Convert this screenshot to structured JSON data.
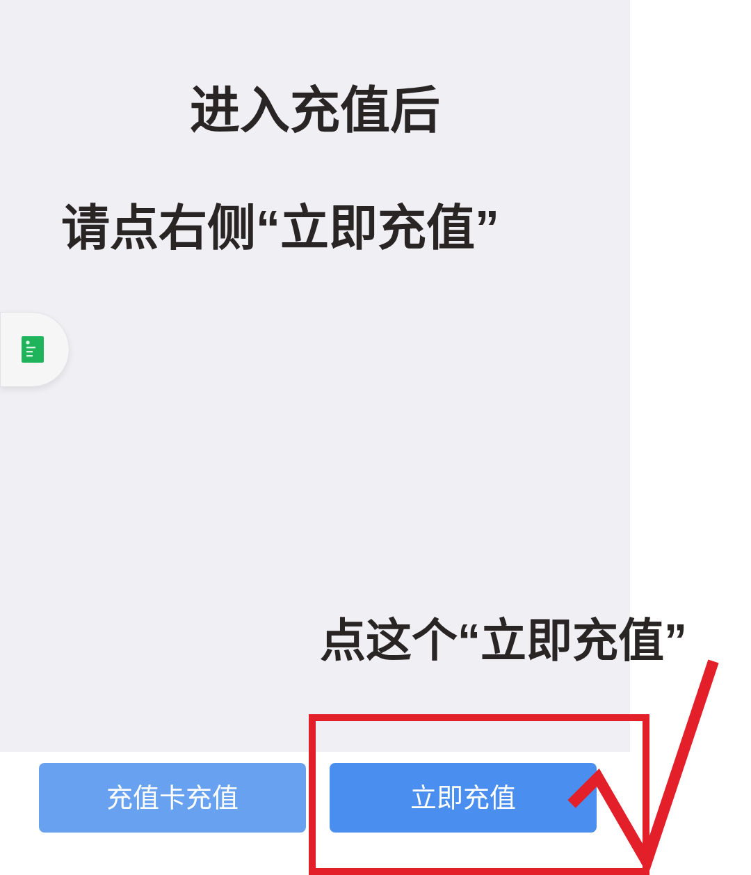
{
  "annotations": {
    "heading": "进入充值后",
    "instruction": "请点右侧“立即充值”",
    "callout": "点这个“立即充值”"
  },
  "buttons": [
    {
      "label": "充值卡充值",
      "kind": "secondary"
    },
    {
      "label": "立即充值",
      "kind": "primary"
    }
  ]
}
